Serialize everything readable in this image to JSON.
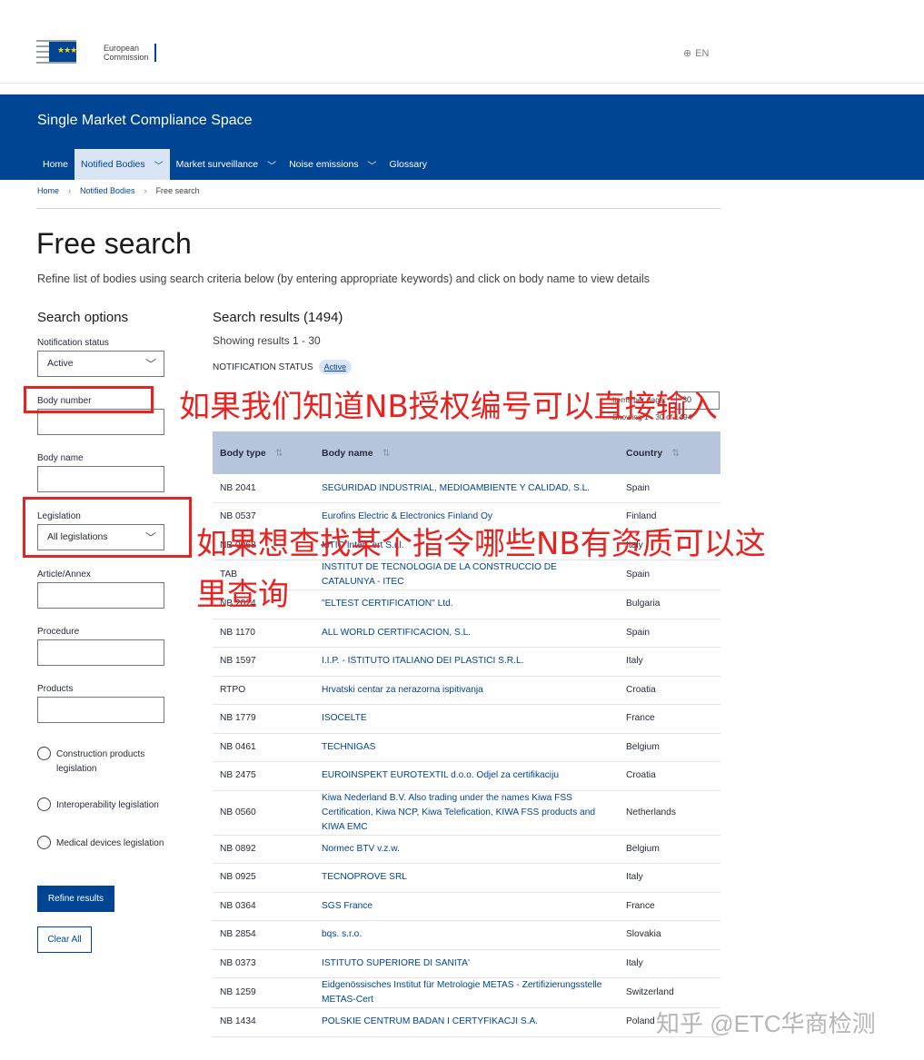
{
  "header": {
    "logo_text_line1": "European",
    "logo_text_line2": "Commission",
    "lang": "EN",
    "site_title": "Single Market Compliance Space"
  },
  "nav": [
    {
      "label": "Home",
      "has_menu": false
    },
    {
      "label": "Notified Bodies",
      "has_menu": true
    },
    {
      "label": "Market surveillance",
      "has_menu": true
    },
    {
      "label": "Noise emissions",
      "has_menu": true
    },
    {
      "label": "Glossary",
      "has_menu": false
    }
  ],
  "breadcrumb": [
    "Home",
    "Notified Bodies",
    "Free search"
  ],
  "page": {
    "title": "Free search",
    "intro": "Refine list of bodies using search criteria below (by entering appropriate keywords) and click on body name to view details"
  },
  "sidebar": {
    "title": "Search options",
    "notification_status_label": "Notification status",
    "notification_status_value": "Active",
    "body_number_label": "Body number",
    "body_name_label": "Body name",
    "legislation_label": "Legislation",
    "legislation_value": "All legislations",
    "article_label": "Article/Annex",
    "procedure_label": "Procedure",
    "products_label": "Products",
    "radio_construction": "Construction products legislation",
    "radio_interop": "Interoperability legislation",
    "radio_medical": "Medical devices legislation",
    "refine_button": "Refine results",
    "clear_button": "Clear All"
  },
  "results": {
    "title": "Search results (1494)",
    "showing": "Showing results 1 - 30",
    "status_label": "NOTIFICATION STATUS",
    "status_pill": "Active",
    "per_page_label": "Items per page:",
    "per_page_value": "30",
    "showing_small": "Showing 1 - 30 of 1494",
    "columns": [
      "Body type",
      "Body name",
      "Country"
    ],
    "rows": [
      [
        "NB 2041",
        "SEGURIDAD INDUSTRIAL, MEDIOAMBIENTE Y CALIDAD, S.L.",
        "Spain"
      ],
      [
        "NB 0537",
        "Eurofins Electric & Electronics Finland Oy",
        "Finland"
      ],
      [
        "NB 0068",
        "MTIC InterCert S.r.l.",
        "Italy"
      ],
      [
        "TAB",
        "INSTITUT DE TECNOLOGIA DE LA CONSTRUCCIO DE CATALUNYA - ITEC",
        "Spain"
      ],
      [
        "NB 2024",
        "\"ELTEST CERTIFICATION\" Ltd.",
        "Bulgaria"
      ],
      [
        "NB 1170",
        "ALL WORLD CERTIFICACION, S.L.",
        "Spain"
      ],
      [
        "NB 1597",
        "I.I.P. - ISTITUTO ITALIANO DEI PLASTICI S.R.L.",
        "Italy"
      ],
      [
        "RTPO",
        "Hrvatski centar za nerazorna ispitivanja",
        "Croatia"
      ],
      [
        "NB 1779",
        "ISOCELTE",
        "France"
      ],
      [
        "NB 0461",
        "TECHNIGAS",
        "Belgium"
      ],
      [
        "NB 2475",
        "EUROINSPEKT EUROTEXTIL d.o.o. Odjel za certifikaciju",
        "Croatia"
      ],
      [
        "NB 0560",
        "Kiwa Nederland B.V. Also trading under the names Kiwa FSS Certification, Kiwa NCP, Kiwa Telefication, KIWA FSS products and KIWA EMC",
        "Netherlands"
      ],
      [
        "NB 0892",
        "Normec BTV v.z.w.",
        "Belgium"
      ],
      [
        "NB 0925",
        "TECNOPROVE SRL",
        "Italy"
      ],
      [
        "NB 0364",
        "SGS France",
        "France"
      ],
      [
        "NB 2854",
        "bqs. s.r.o.",
        "Slovakia"
      ],
      [
        "NB 0373",
        "ISTITUTO SUPERIORE DI SANITA'",
        "Italy"
      ],
      [
        "NB 1259",
        "Eidgenössisches Institut für Metrologie METAS - Zertifizierungsstelle METAS-Cert",
        "Switzerland"
      ],
      [
        "NB 1434",
        "POLSKIE CENTRUM BADAN I CERTYFIKACJI S.A.",
        "Poland"
      ]
    ]
  },
  "annotations": {
    "note1": "如果我们知道NB授权编号可以直接输入",
    "note2_line1": "如果想查找某个指令哪些NB有资质可以这",
    "note2_line2": "里查询",
    "watermark": "知乎 @ETC华商检测"
  },
  "colors": {
    "brand": "#004494",
    "annotation": "#e8231f"
  }
}
